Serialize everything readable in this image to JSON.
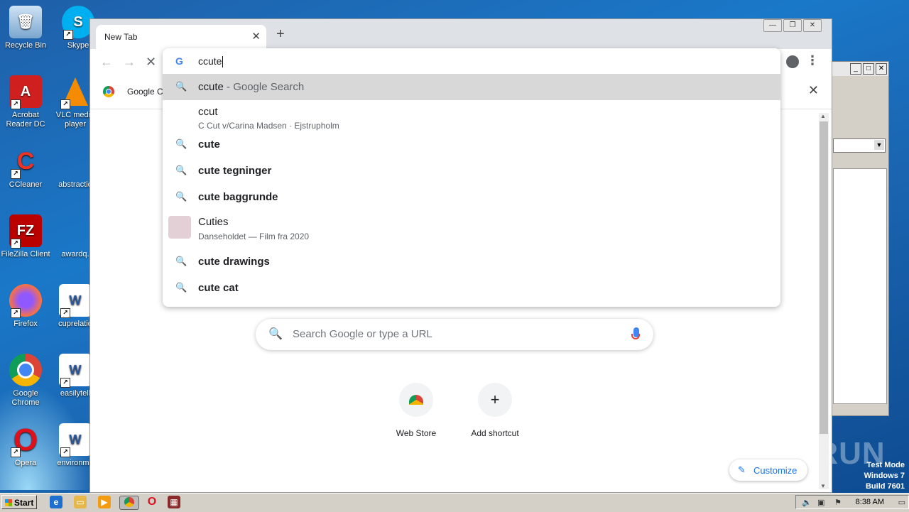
{
  "desktop": {
    "icons": [
      {
        "label": "Recycle Bin",
        "icon": "recycle-bin-icon"
      },
      {
        "label": "Skype",
        "icon": "skype-icon"
      },
      {
        "label": "Acrobat Reader DC",
        "icon": "acrobat-icon"
      },
      {
        "label": "VLC media player",
        "icon": "vlc-icon"
      },
      {
        "label": "CCleaner",
        "icon": "ccleaner-icon"
      },
      {
        "label": "abstractio",
        "icon": "document-icon"
      },
      {
        "label": "FileZilla Client",
        "icon": "filezilla-icon"
      },
      {
        "label": "awardq.",
        "icon": "document-icon"
      },
      {
        "label": "Firefox",
        "icon": "firefox-icon"
      },
      {
        "label": "cuprelatio",
        "icon": "word-doc-icon"
      },
      {
        "label": "Google Chrome",
        "icon": "chrome-icon"
      },
      {
        "label": "easilytell",
        "icon": "word-doc-icon"
      },
      {
        "label": "Opera",
        "icon": "opera-icon"
      },
      {
        "label": "environme",
        "icon": "word-doc-icon"
      }
    ]
  },
  "browser": {
    "tab_title": "New Tab",
    "tab_close": "✕",
    "new_tab": "+",
    "bookmark_label": "Google Cl",
    "omnibox": {
      "text": "ccute",
      "suggestions": [
        {
          "main": "ccute",
          "suffix": " - Google Search",
          "type": "search",
          "selected": true
        },
        {
          "main": "ccut",
          "sub": "C Cut v/Carina Madsen · Ejstrupholm",
          "type": "place"
        },
        {
          "main": "cute",
          "type": "search"
        },
        {
          "main": "cute tegninger",
          "type": "search"
        },
        {
          "main": "cute baggrunde",
          "type": "search"
        },
        {
          "main": "Cuties",
          "sub": "Danseholdet — Film fra 2020",
          "type": "entity"
        },
        {
          "main": "cute drawings",
          "type": "search"
        },
        {
          "main": "cute cat",
          "type": "search"
        }
      ]
    },
    "ntp": {
      "search_placeholder": "Search Google or type a URL",
      "shortcuts": [
        {
          "label": "Web Store"
        },
        {
          "label": "Add shortcut"
        }
      ],
      "customize": "Customize"
    }
  },
  "overlay": {
    "watermark": "ANY RUN",
    "test_mode": [
      "Test Mode",
      "Windows 7",
      "Build 7601"
    ]
  },
  "taskbar": {
    "start": "Start",
    "clock": "8:38 AM"
  }
}
